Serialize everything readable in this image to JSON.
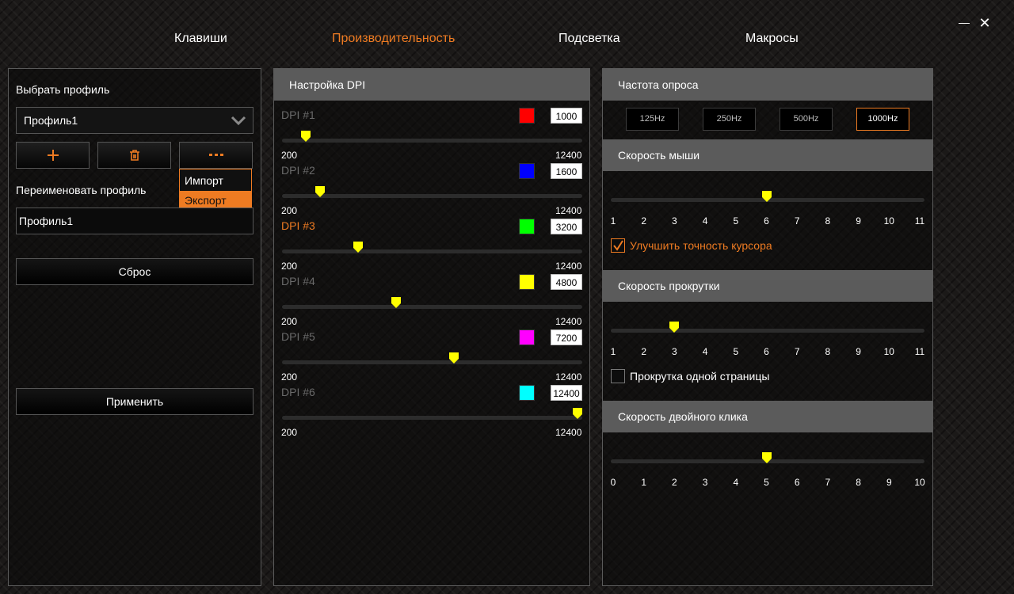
{
  "window": {
    "minimize_symbol": "—",
    "close_symbol": "✕"
  },
  "nav": {
    "tabs": [
      {
        "label": "Клавиши"
      },
      {
        "label": "Производительность",
        "active": true
      },
      {
        "label": "Подсветка"
      },
      {
        "label": "Макросы"
      }
    ]
  },
  "profile": {
    "select_label": "Выбрать профиль",
    "selected": "Профиль1",
    "menu_items": [
      "Импорт",
      "Экспорт"
    ],
    "rename_label": "Переименовать профиль",
    "rename_value": "Профиль1",
    "reset_label": "Сброс",
    "apply_label": "Применить"
  },
  "dpi": {
    "title": "Настройка DPI",
    "min_label": "200",
    "max_label": "12400",
    "min": 200,
    "max": 12400,
    "active_index": 2,
    "levels": [
      {
        "name": "DPI #1",
        "value": "1000",
        "color": "#ff0000"
      },
      {
        "name": "DPI #2",
        "value": "1600",
        "color": "#0000ff"
      },
      {
        "name": "DPI #3",
        "value": "3200",
        "color": "#00ff00"
      },
      {
        "name": "DPI #4",
        "value": "4800",
        "color": "#ffff00"
      },
      {
        "name": "DPI #5",
        "value": "7200",
        "color": "#ff00ff"
      },
      {
        "name": "DPI #6",
        "value": "12400",
        "color": "#00ffff"
      }
    ]
  },
  "polling": {
    "title": "Частота опроса",
    "options": [
      "125Hz",
      "250Hz",
      "500Hz",
      "1000Hz"
    ],
    "selected_index": 3
  },
  "mouse_speed": {
    "title": "Скорость мыши",
    "ticks": [
      "1",
      "2",
      "3",
      "4",
      "5",
      "6",
      "7",
      "8",
      "9",
      "10",
      "11"
    ],
    "value": 6,
    "checkbox_label": "Улучшить точность курсора",
    "checkbox_checked": true
  },
  "scroll_speed": {
    "title": "Скорость прокрутки",
    "ticks": [
      "1",
      "2",
      "3",
      "4",
      "5",
      "6",
      "7",
      "8",
      "9",
      "10",
      "11"
    ],
    "value": 3,
    "checkbox_label": "Прокрутка одной страницы",
    "checkbox_checked": false
  },
  "double_click": {
    "title": "Скорость двойного клика",
    "ticks": [
      "0",
      "1",
      "2",
      "3",
      "4",
      "5",
      "6",
      "7",
      "8",
      "9",
      "10"
    ],
    "value": 5
  },
  "colors": {
    "accent": "#ee7b22",
    "thumb": "#ffff00",
    "header": "#5b5b5b"
  }
}
